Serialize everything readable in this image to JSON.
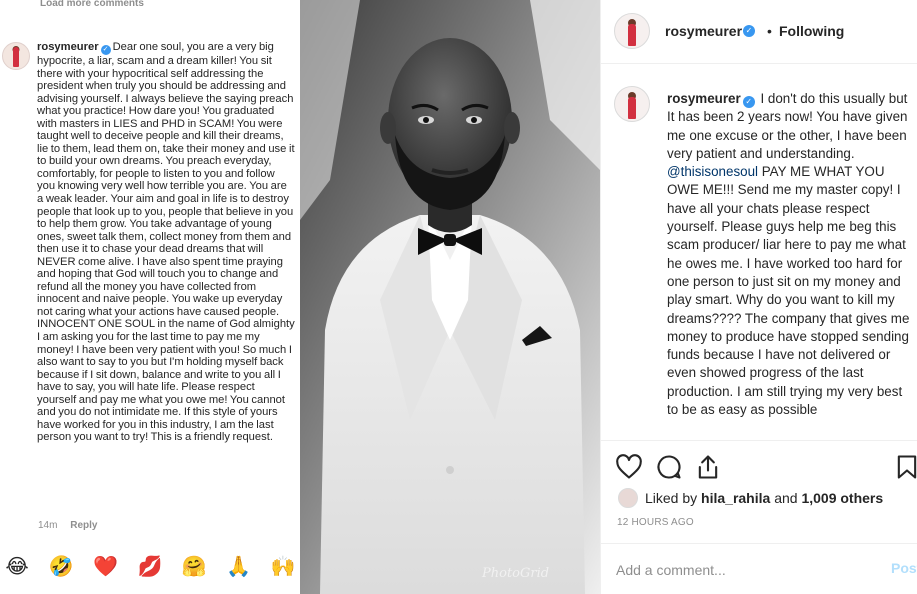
{
  "left_comment": {
    "load_more": "Load more comments",
    "username": "rosymeurer",
    "text": "Dear one soul, you are a very big hypocrite, a liar, scam and a dream killer! You sit there with your hypocritical self addressing the president when truly you should be addressing and advising yourself. I always believe the saying preach what you practice! How dare you! You graduated with masters in LIES and PHD in SCAM! You were taught well to deceive people and kill their dreams, lie to them, lead them on, take their money and use it to build your own dreams. You preach everyday, comfortably, for people to listen to you and follow you knowing very well how terrible you are. You are a weak leader. Your aim and goal in life is to destroy people that look up to you, people that believe in you to help them grow. You take advantage of young ones, sweet talk them, collect money from them and then use it to chase your dead dreams that will NEVER come alive. I have also spent time praying and hoping that God will touch you to change and refund all the money you have collected from innocent and naive people. You wake up everyday not caring what your actions have caused people. INNOCENT ONE SOUL in the name of God almighty I am asking you for the last time to pay me my money! I have been very patient with you! So much I also want to say to you but I'm holding myself back because if I sit down, balance and write to you all I have to say, you will hate life. Please respect yourself and pay me what you owe me! You cannot and you do not intimidate me. If this style of yours have worked for you in this industry, I am the last person you want to try! This is a friendly request.",
    "time": "14m",
    "reply": "Reply",
    "emojis": [
      "😂",
      "🤣",
      "❤️",
      "💋",
      "🤗",
      "🙏",
      "🙌"
    ]
  },
  "photo": {
    "watermark": "PhotoGrid"
  },
  "post": {
    "username": "rosymeurer",
    "follow_status": "Following",
    "separator": "•",
    "caption_username": "rosymeurer",
    "caption_part1": "I don't do this usually but It has been 2 years now! You have given me one excuse or the other, I have been very patient and understanding.",
    "mention": "@thisisonesoul",
    "caption_part2": "PAY ME WHAT YOU OWE ME!!! Send me my master copy! I have all your chats please respect yourself. Please guys help me beg this scam producer/ liar here to pay me what he owes me. I have worked too hard for one person to just sit on my money and play smart. Why do you want to kill my dreams???? The company that gives me money to produce have stopped sending funds because I have not delivered or even showed progress of the last production. I am still trying my very best to be as easy as possible",
    "liked_by_prefix": "Liked by",
    "liked_by_user": "hila_rahila",
    "liked_by_and": "and",
    "liked_by_others": "1,009 others",
    "timestamp": "12 HOURS AGO",
    "comment_placeholder": "Add a comment...",
    "post_button": "Post"
  },
  "colors": {
    "link": "#003569",
    "verified": "#3897f0",
    "post_button": "#b2dffc"
  }
}
